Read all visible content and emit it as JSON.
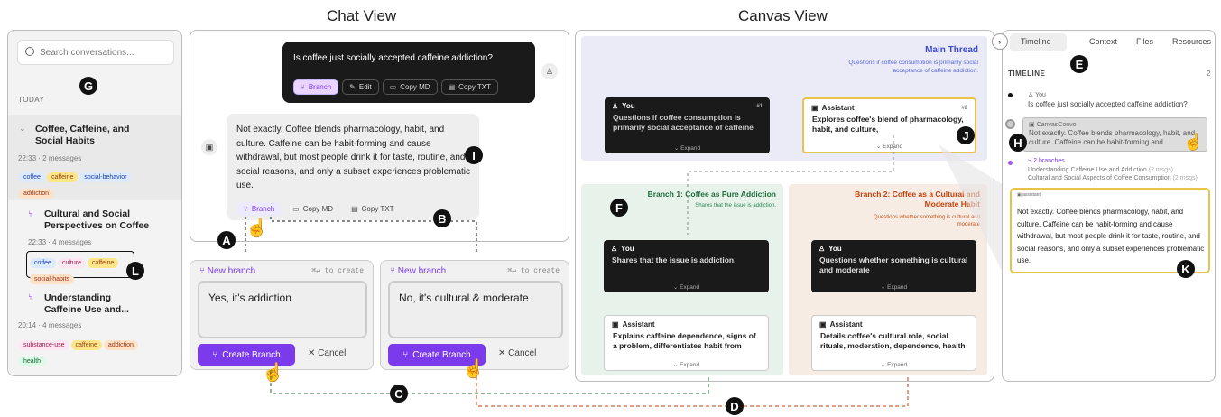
{
  "headers": {
    "chat": "Chat View",
    "canvas": "Canvas View"
  },
  "markers": {
    "A": "A",
    "B": "B",
    "C": "C",
    "D": "D",
    "E": "E",
    "F": "F",
    "G": "G",
    "H": "H",
    "I": "I",
    "J": "J",
    "K": "K",
    "L": "L"
  },
  "sidebar": {
    "search_placeholder": "Search conversations...",
    "section": "TODAY",
    "convs": [
      {
        "title": "Coffee, Caffeine, and",
        "title2": "Social Habits",
        "time": "22:33",
        "count": "2 messages",
        "tags": [
          "coffee",
          "caffeine",
          "social-behavior",
          "addiction"
        ]
      },
      {
        "title": "Cultural and Social",
        "title2": "Perspectives on Coffee",
        "time": "22:33",
        "count": "4 messages",
        "tags": [
          "coffee",
          "culture",
          "caffeine",
          "social-habits"
        ]
      },
      {
        "title": "Understanding",
        "title2": "Caffeine Use and...",
        "time": "20:14",
        "count": "4 messages",
        "tags": [
          "substance-use",
          "caffeine",
          "addiction",
          "health"
        ]
      }
    ]
  },
  "chat": {
    "user_msg": "Is coffee just socially accepted caffeine addiction?",
    "user_actions": [
      "Branch",
      "Edit",
      "Copy MD",
      "Copy TXT"
    ],
    "assistant_msg": "Not exactly. Coffee blends pharmacology, habit, and culture. Caffeine can be habit-forming and cause withdrawal, but most people drink it for taste, routine, and social reasons, and only a subset experiences problematic use.",
    "assistant_actions": [
      "Branch",
      "Copy MD",
      "Copy TXT"
    ]
  },
  "branch_left": {
    "head": "New branch",
    "hint": "⌘↵ to create",
    "value": "Yes, it's addiction",
    "create": "Create Branch",
    "cancel": "Cancel"
  },
  "branch_right": {
    "head": "New branch",
    "hint": "⌘↵ to create",
    "value": "No, it's cultural & moderate",
    "create": "Create Branch",
    "cancel": "Cancel"
  },
  "canvas": {
    "main_title": "Main Thread",
    "main_sub": "Questions if coffee consumption is primarily social acceptance of caffeine addiction.",
    "you_label": "You",
    "assistant_label": "Assistant",
    "main_you": "Questions if coffee consumption is primarily social acceptance of caffeine",
    "main_asst": "Explores coffee's blend of pharmacology, habit, and culture,",
    "expand": "Expand",
    "b1_title": "Branch 1: Coffee as Pure Addiction",
    "b1_sub": "Shares that the issue is addiction.",
    "b1_you": "Shares that the issue is addiction.",
    "b1_asst": "Explains caffeine dependence, signs of a problem, differentiates habit from",
    "b2_title": "Branch 2: Coffee as a Cultural and Moderate Habit",
    "b2_sub": "Questions whether something is cultural and moderate",
    "b2_you": "Questions whether something is cultural and moderate",
    "b2_asst": "Details coffee's cultural role, social rituals, moderation, dependence, health",
    "badge_you": "#1",
    "badge_asst": "#2"
  },
  "right": {
    "tabs": [
      "Timeline",
      "Context",
      "Files",
      "Resources"
    ],
    "section": "TIMELINE",
    "section_count": "2",
    "you": "You",
    "you_msg": "Is coffee just socially accepted caffeine addiction?",
    "bot": "CanvasConvo",
    "bot_msg": "Not exactly. Coffee blends pharmacology, habit, and culture. Caffeine can be habit-forming and",
    "branches": "2 branches",
    "b1": "Understanding Caffeine Use and Addiction",
    "b1_count": "(2 msgs)",
    "b2": "Cultural and Social Aspects of Coffee Consumption",
    "b2_count": "(2 msgs)",
    "expanded": "Not exactly. Coffee blends pharmacology, habit, and culture. Caffeine can be habit-forming and cause withdrawal, but most people drink it for taste, routine, and social reasons, and only a subset experiences problematic use."
  },
  "colors": {
    "purple": "#7c3aed",
    "green": "#1f6b3a",
    "orange": "#c2410c",
    "gold": "#e8c34a"
  }
}
